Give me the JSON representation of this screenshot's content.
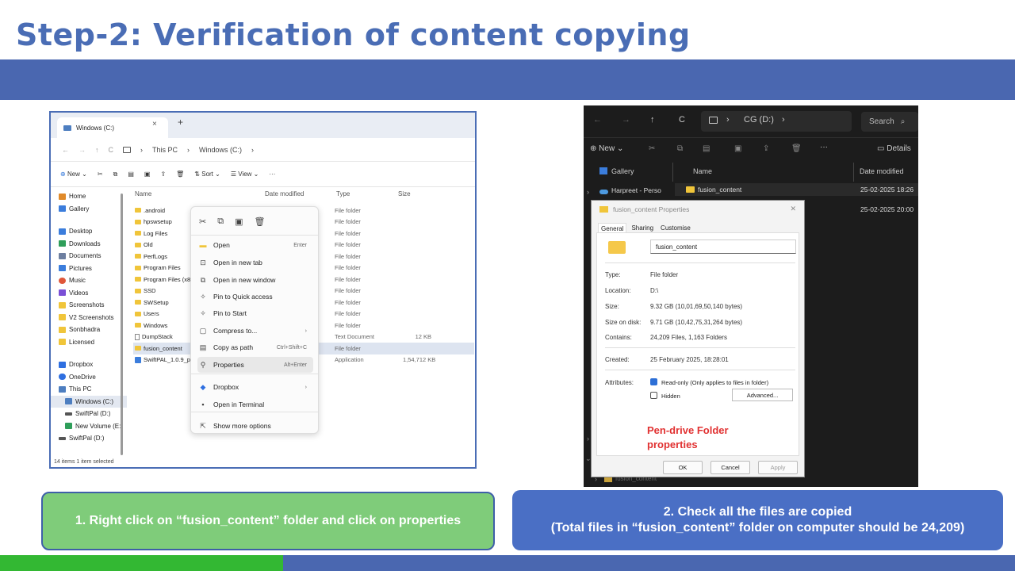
{
  "slide": {
    "title": "Step-2: Verification of content copying"
  },
  "left_window": {
    "tab_title": "Windows (C:)",
    "tab_close": "×",
    "tab_add": "+",
    "nav": {
      "back": "←",
      "forward": "→",
      "up": "↑",
      "refresh": "C",
      "sep1": "›",
      "this_pc": "This PC",
      "sep2": "›",
      "drive": "Windows (C:)",
      "sep3": "›"
    },
    "toolbar": {
      "new": "New",
      "sort": "Sort",
      "view": "View",
      "more": "···"
    },
    "sidebar": [
      {
        "label": "Home",
        "icon": "home-icon",
        "color": "#e08a2a"
      },
      {
        "label": "Gallery",
        "icon": "gallery-icon",
        "color": "#3b7ddc"
      },
      {
        "label": "Desktop",
        "icon": "desktop-icon",
        "color": "#3b7ddc"
      },
      {
        "label": "Downloads",
        "icon": "downloads-icon",
        "color": "#2f9e5a"
      },
      {
        "label": "Documents",
        "icon": "documents-icon",
        "color": "#6d7fa0"
      },
      {
        "label": "Pictures",
        "icon": "pictures-icon",
        "color": "#3b7ddc"
      },
      {
        "label": "Music",
        "icon": "music-icon",
        "color": "#e0573a"
      },
      {
        "label": "Videos",
        "icon": "videos-icon",
        "color": "#7a4fd6"
      },
      {
        "label": "Screenshots",
        "icon": "folder-icon",
        "color": "#f0c53a"
      },
      {
        "label": "V2 Screenshots",
        "icon": "folder-icon",
        "color": "#f0c53a"
      },
      {
        "label": "Sonbhadra",
        "icon": "folder-icon",
        "color": "#f0c53a"
      },
      {
        "label": "Licensed",
        "icon": "folder-icon",
        "color": "#f0c53a"
      },
      {
        "label": "Dropbox",
        "icon": "dropbox-icon",
        "color": "#2f6fe0"
      },
      {
        "label": "OneDrive",
        "icon": "onedrive-icon",
        "color": "#2f6fe0"
      },
      {
        "label": "This PC",
        "icon": "pc-icon",
        "color": "#4d7ec0"
      },
      {
        "label": "Windows (C:)",
        "icon": "drive-icon",
        "color": "#4d7ec0"
      },
      {
        "label": "SwiftPal (D:)",
        "icon": "drive-icon",
        "color": "#555555"
      },
      {
        "label": "New Volume (E:)",
        "icon": "drive-icon",
        "color": "#2f9e5a"
      },
      {
        "label": "SwiftPal (D:)",
        "icon": "drive-icon",
        "color": "#555555"
      }
    ],
    "status": "14 items   1 item selected",
    "columns": {
      "name": "Name",
      "date": "Date modified",
      "type": "Type",
      "size": "Size"
    },
    "files": [
      {
        "name": ".android",
        "type": "File folder",
        "size": ""
      },
      {
        "name": "hpswsetup",
        "type": "File folder",
        "size": ""
      },
      {
        "name": "Log Files",
        "type": "File folder",
        "size": ""
      },
      {
        "name": "Old",
        "type": "File folder",
        "size": ""
      },
      {
        "name": "PerfLogs",
        "type": "File folder",
        "size": ""
      },
      {
        "name": "Program Files",
        "type": "File folder",
        "size": ""
      },
      {
        "name": "Program Files (x86)",
        "type": "File folder",
        "size": ""
      },
      {
        "name": "SSD",
        "type": "File folder",
        "size": ""
      },
      {
        "name": "SWSetup",
        "type": "File folder",
        "size": ""
      },
      {
        "name": "Users",
        "type": "File folder",
        "size": ""
      },
      {
        "name": "Windows",
        "type": "File folder",
        "size": ""
      },
      {
        "name": "DumpStack",
        "type": "Text Document",
        "size": "12 KB"
      },
      {
        "name": "fusion_content",
        "type": "File folder",
        "size": ""
      },
      {
        "name": "SwiftPAL_1.0.9_prod",
        "type": "Application",
        "size": "1,54,712 KB"
      }
    ],
    "context_menu": {
      "items": [
        {
          "label": "Open",
          "shortcut": "Enter",
          "icon": "folder-icon"
        },
        {
          "label": "Open in new tab",
          "shortcut": "",
          "icon": "new-tab-icon"
        },
        {
          "label": "Open in new window",
          "shortcut": "",
          "icon": "new-window-icon"
        },
        {
          "label": "Pin to Quick access",
          "shortcut": "",
          "icon": "pin-icon"
        },
        {
          "label": "Pin to Start",
          "shortcut": "",
          "icon": "pin-start-icon"
        },
        {
          "label": "Compress to...",
          "shortcut": "›",
          "icon": "compress-icon"
        },
        {
          "label": "Copy as path",
          "shortcut": "Ctrl+Shift+C",
          "icon": "copy-path-icon"
        },
        {
          "label": "Properties",
          "shortcut": "Alt+Enter",
          "icon": "properties-icon"
        },
        {
          "label": "Dropbox",
          "shortcut": "›",
          "icon": "dropbox-icon"
        },
        {
          "label": "Open in Terminal",
          "shortcut": "",
          "icon": "terminal-icon"
        },
        {
          "label": "Show more options",
          "shortcut": "",
          "icon": "more-options-icon"
        }
      ]
    }
  },
  "right_window": {
    "nav": {
      "back": "←",
      "forward": "→",
      "up": "↑",
      "refresh": "C",
      "sep1": "›",
      "drive": "CG (D:)",
      "sep2": "›"
    },
    "search": "Search",
    "toolbar": {
      "new": "New",
      "more": "···",
      "details": "Details"
    },
    "sidebar": [
      {
        "label": "Gallery"
      },
      {
        "label": "Harpreet - Perso"
      }
    ],
    "columns": {
      "name": "Name",
      "date": "Date modified"
    },
    "rows": [
      {
        "name": "fusion_content",
        "date": "25-02-2025 18:26"
      },
      {
        "name": "",
        "date": "25-02-2025 20:00"
      }
    ],
    "bottom_item": "fusion_content",
    "dialog": {
      "title": "fusion_content Properties",
      "close": "✕",
      "tabs": [
        "General",
        "Sharing",
        "Customise"
      ],
      "name": "fusion_content",
      "type_label": "Type:",
      "type": "File folder",
      "location_label": "Location:",
      "location": "D:\\",
      "size_label": "Size:",
      "size": "9.32 GB (10,01,69,50,140 bytes)",
      "size_on_disk_label": "Size on disk:",
      "size_on_disk": "9.71 GB (10,42,75,31,264 bytes)",
      "contains_label": "Contains:",
      "contains": "24,209 Files, 1,163 Folders",
      "created_label": "Created:",
      "created": "25 February 2025, 18:28:01",
      "attributes_label": "Attributes:",
      "readonly": "Read-only (Only applies to files in folder)",
      "hidden": "Hidden",
      "advanced": "Advanced...",
      "ok": "OK",
      "cancel": "Cancel",
      "apply": "Apply"
    },
    "annotation": {
      "line1": "Pen-drive Folder",
      "line2": "properties"
    }
  },
  "captions": {
    "step1": "1. Right click on “fusion_content” folder and click on properties",
    "step2_line1": "2. Check all the files are copied",
    "step2_line2": "(Total files in “fusion_content” folder on computer should be 24,209)"
  },
  "colors": {
    "title": "#4a6db5",
    "band": "#4a67b0",
    "caption1": "#7fcc7a",
    "caption2": "#4a6fc5",
    "annotation": "#e13131"
  }
}
